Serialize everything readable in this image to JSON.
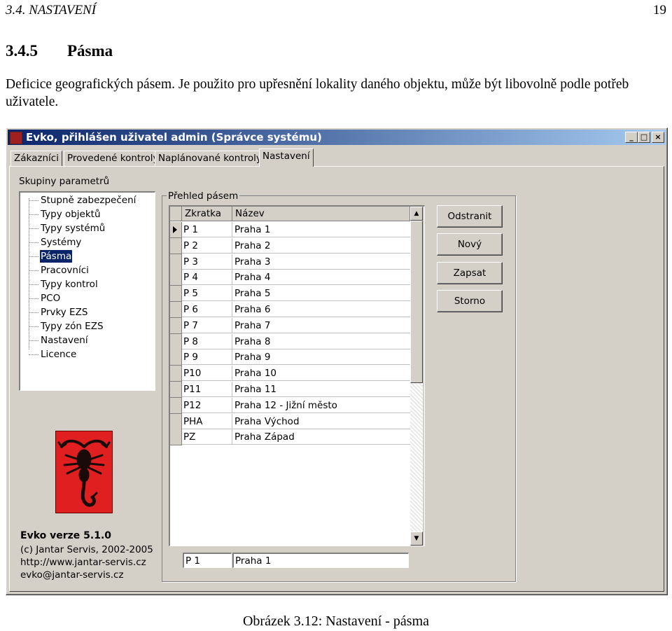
{
  "doc": {
    "chapter": "3.4.  NASTAVENÍ",
    "page": "19",
    "section_number": "3.4.5",
    "section_title": "Pásma",
    "paragraph": "Deficice geografických pásem. Je použito pro upřesnění lokality daného objektu, může být libovolně podle potřeb uživatele.",
    "caption": "Obrázek 3.12: Nastavení - pásma"
  },
  "window": {
    "title": "Evko, přihlášen uživatel admin (Správce systému)",
    "controls": [
      "_",
      "□",
      "×"
    ]
  },
  "tabs": [
    "Zákazníci",
    "Provedené kontroly",
    "Naplánované kontroly",
    "Nastavení"
  ],
  "active_tab": "Nastavení",
  "sidebar": {
    "group_label": "Skupiny parametrů",
    "items": [
      "Stupně zabezpečení",
      "Typy objektů",
      "Typy systémů",
      "Systémy",
      "Pásma",
      "Pracovníci",
      "Typy kontrol",
      "PCO",
      "Prvky EZS",
      "Typy zón EZS",
      "Nastavení",
      "Licence"
    ],
    "selected": "Pásma"
  },
  "about": {
    "version": "Evko verze 5.1.0",
    "copyright": "(c) Jantar Servis, 2002-2005",
    "url": "http://www.jantar-servis.cz",
    "email": "evko@jantar-servis.cz"
  },
  "panel": {
    "group_label": "Přehled pásem",
    "columns": [
      "Zkratka",
      "Název"
    ],
    "rows": [
      [
        "P 1",
        "Praha 1"
      ],
      [
        "P 2",
        "Praha 2"
      ],
      [
        "P 3",
        "Praha 3"
      ],
      [
        "P 4",
        "Praha 4"
      ],
      [
        "P 5",
        "Praha 5"
      ],
      [
        "P 6",
        "Praha 6"
      ],
      [
        "P 7",
        "Praha 7"
      ],
      [
        "P 8",
        "Praha 8"
      ],
      [
        "P 9",
        "Praha 9"
      ],
      [
        "P10",
        "Praha 10"
      ],
      [
        "P11",
        "Praha 11"
      ],
      [
        "P12",
        "Praha 12 - Jižní město"
      ],
      [
        "PHA",
        "Praha Východ"
      ],
      [
        "PZ",
        "Praha  Západ"
      ]
    ],
    "current_row": 0,
    "edit_code": "P 1",
    "edit_name": "Praha 1"
  },
  "buttons": [
    "Odstranit",
    "Nový",
    "Zapsat",
    "Storno"
  ]
}
